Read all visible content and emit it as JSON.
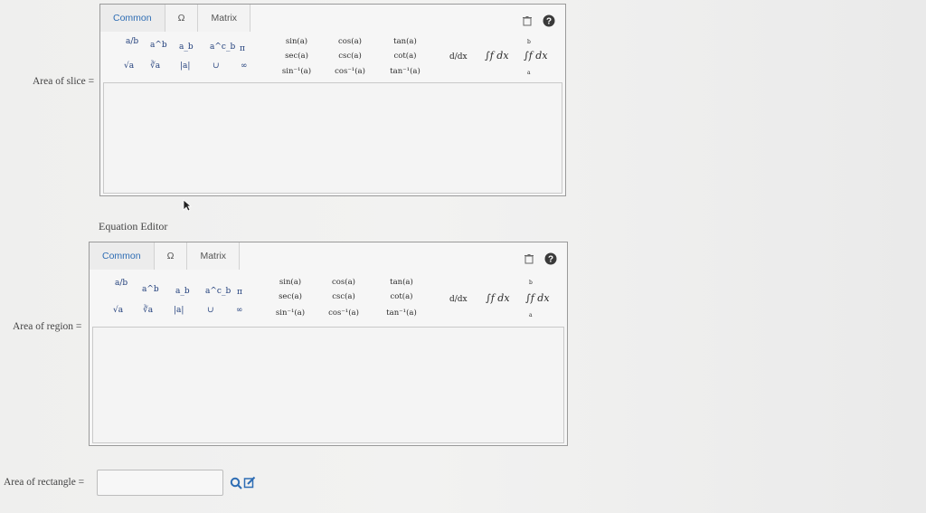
{
  "editor1": {
    "tabs": [
      "Common",
      "Ω",
      "Matrix"
    ],
    "symbols_row1": [
      "a/b",
      "a^b",
      "a_b",
      "a^c_b",
      "π"
    ],
    "symbols_row2": [
      "√a",
      "∛a",
      "|a|",
      "∪",
      "∞"
    ],
    "trig": [
      "sin(a)",
      "cos(a)",
      "tan(a)",
      "sec(a)",
      "csc(a)",
      "cot(a)",
      "sin⁻¹(a)",
      "cos⁻¹(a)",
      "tan⁻¹(a)"
    ],
    "deriv": "d/dx",
    "integral": "∫f dx",
    "def_integral": "∫f dx",
    "def_upper": "b",
    "def_lower": "a"
  },
  "editor2": {
    "tabs": [
      "Common",
      "Ω",
      "Matrix"
    ],
    "symbols_row1": [
      "a/b",
      "a^b",
      "a_b",
      "a^c_b",
      "π"
    ],
    "symbols_row2": [
      "√a",
      "∛a",
      "|a|",
      "∪",
      "∞"
    ],
    "trig": [
      "sin(a)",
      "cos(a)",
      "tan(a)",
      "sec(a)",
      "csc(a)",
      "cot(a)",
      "sin⁻¹(a)",
      "cos⁻¹(a)",
      "tan⁻¹(a)"
    ],
    "deriv": "d/dx",
    "integral": "∫f dx",
    "def_integral": "∫f dx",
    "def_upper": "b",
    "def_lower": "a"
  },
  "labels": {
    "area_slice": "Area of slice =",
    "equation_editor": "Equation Editor",
    "area_region": "Area of region =",
    "area_rectangle": "Area of rectangle ="
  },
  "colors": {
    "tab_active": "#2e6db4",
    "symbol": "#1f3d7a"
  }
}
